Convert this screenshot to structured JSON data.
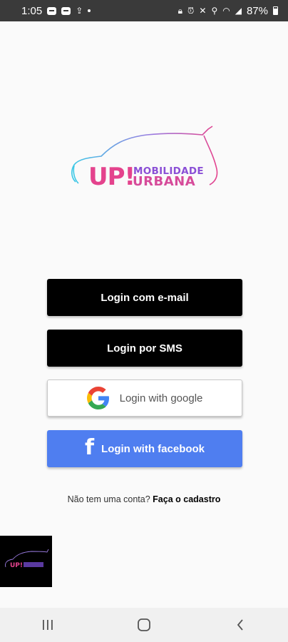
{
  "status_bar": {
    "time": "1:05",
    "battery": "87%"
  },
  "logo": {
    "mark": "UP!",
    "line1": "MOBILIDADE",
    "line2": "URBANA",
    "colors": {
      "cyan": "#3cc8e6",
      "pink": "#e4438d",
      "purple": "#8a4fd6"
    }
  },
  "buttons": {
    "email_label": "Login com e-mail",
    "sms_label": "Login por SMS",
    "google_label": "Login with google",
    "facebook_label": "Login with facebook"
  },
  "signup": {
    "prompt": "Não tem uma conta?",
    "link": "Faça o cadastro"
  },
  "icons": {
    "google": "google-icon",
    "facebook": "facebook-icon",
    "nav_recents": "recents-icon",
    "nav_home": "home-icon",
    "nav_back": "back-icon"
  },
  "colors": {
    "primary_button": "#000000",
    "facebook_button": "#4f7ef0",
    "background": "#fafafa"
  }
}
